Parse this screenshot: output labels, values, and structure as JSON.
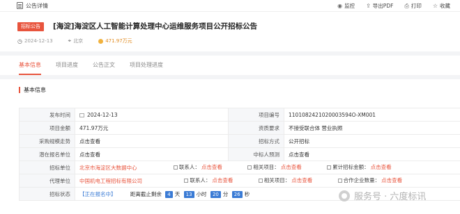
{
  "topbar": {
    "title": "公告详情",
    "actions": {
      "monitor": "监控",
      "export_pdf": "导出PDF",
      "print": "打印",
      "favorite": "收藏"
    }
  },
  "header": {
    "tag": "招标公告",
    "title": "[海淀]海淀区人工智能计算处理中心运维服务项目公开招标公告",
    "date": "2024-12-13",
    "region": "北京",
    "amount": "471.97万元"
  },
  "tabs": [
    "基本信息",
    "项目进度",
    "公告正文",
    "项目处理进度"
  ],
  "section": {
    "title": "基本信息"
  },
  "table": {
    "r1": {
      "l1": "发布时间",
      "v1": "2024-12-13",
      "l2": "项目编号",
      "v2": "1101082421020003594O-XM001"
    },
    "r2": {
      "l1": "项目金额",
      "v1": "471.97万元",
      "l2": "资质要求",
      "v2": "不接受联合体 营业执照"
    },
    "r3": {
      "l1": "采购规模走势",
      "v1": "点击查看",
      "l2": "招标方式",
      "v2": "公开招标"
    },
    "r4": {
      "l1": "潜在报名单位",
      "v1": "点击查看",
      "l2": "中标人预测",
      "v2": "点击查看"
    },
    "r5": {
      "label": "招标单位",
      "org": "北京市海淀区大数据中心",
      "contact_label": "联系人：",
      "contact_link": "点击查看",
      "related_label": "相关项目：",
      "related_link": "点击查看",
      "total_label": "累计招标金额：",
      "total_link": "点击查看"
    },
    "r6": {
      "label": "代理单位",
      "org": "中国机电工程招标有限公司",
      "contact_label": "联系人：",
      "contact_link": "点击查看",
      "related_label": "相关项目：",
      "related_link": "点击查看",
      "total_label": "合作企业数量：",
      "total_link": "点击查看"
    },
    "r7": {
      "label": "招标状态",
      "status": "【正在报名中】",
      "deadline_label": "距离截止剩余",
      "days": "4",
      "days_unit": "天",
      "hours": "13",
      "hours_unit": "小时",
      "minutes": "20",
      "minutes_unit": "分",
      "seconds": "26",
      "seconds_unit": "秒"
    }
  },
  "watermark": "服务号 · 六度标讯",
  "colors": {
    "accent": "#e8543d",
    "status_blue": "#3a7bd5",
    "amount_orange": "#e08a1e"
  },
  "icons": [
    "document-icon",
    "monitor-icon",
    "export-icon",
    "print-icon",
    "star-icon",
    "calendar-icon",
    "location-icon",
    "coin-icon"
  ]
}
